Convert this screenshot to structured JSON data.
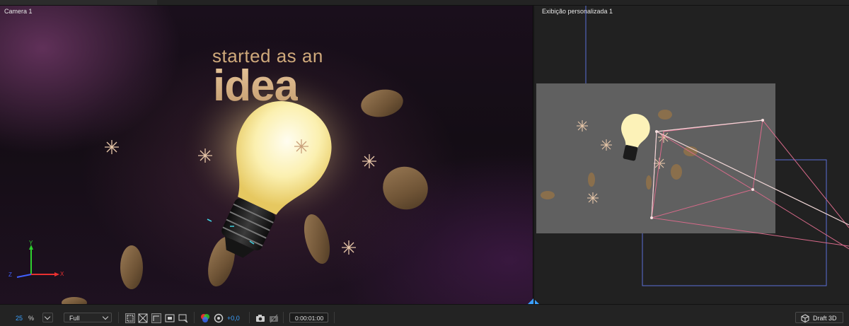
{
  "left_view": {
    "label": "Camera 1"
  },
  "right_view": {
    "label": "Exibição personalizada 1"
  },
  "scene": {
    "line1": "started as an",
    "line2": "idea"
  },
  "axis": {
    "x": "X",
    "y": "Y",
    "z": "Z"
  },
  "toolbar": {
    "zoom_value": "25",
    "zoom_unit": "%",
    "resolution": "Full",
    "exposure": "+0,0",
    "timecode": "0:00:01:00",
    "draft3d": "Draft 3D"
  },
  "colors": {
    "accent": "#3aa0ff",
    "title": "#d8b58a",
    "camera_frame": "#d86a8a",
    "bounds": "#5a6fd6"
  },
  "icons": [
    "chevron-down-icon",
    "region-of-interest-icon",
    "transparency-grid-icon",
    "mask-visibility-icon",
    "guides-icon",
    "grid-icon",
    "color-channels-icon",
    "reset-exposure-icon",
    "snapshot-icon",
    "show-snapshot-icon",
    "draft3d-icon"
  ]
}
